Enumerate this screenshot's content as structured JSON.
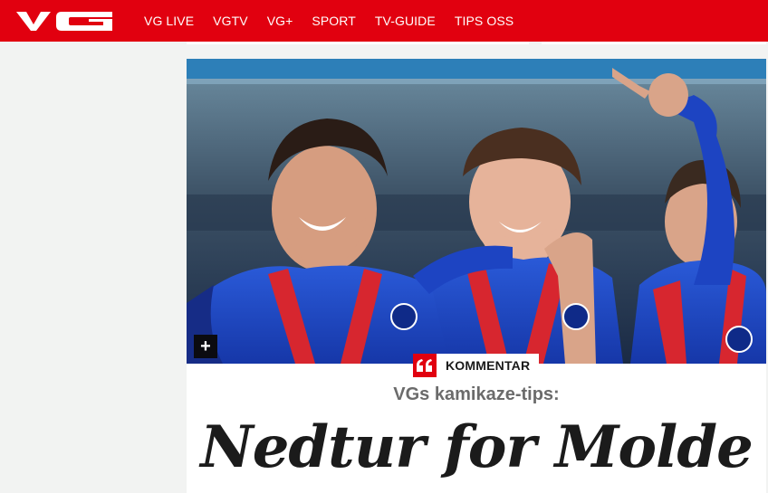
{
  "header": {
    "logo_text": "VG",
    "nav": [
      "VG LIVE",
      "VGTV",
      "VG+",
      "SPORT",
      "TV-GUIDE",
      "TIPS OSS"
    ],
    "brand_color": "#e1000f"
  },
  "article": {
    "image_alt": "Molde-spillere feirer med medaljer",
    "expand_icon": "plus-icon",
    "kicker_icon": "quote-icon",
    "kicker": "KOMMENTAR",
    "subtitle": "VGs kamikaze-tips:",
    "headline": "Nedtur for Molde"
  }
}
